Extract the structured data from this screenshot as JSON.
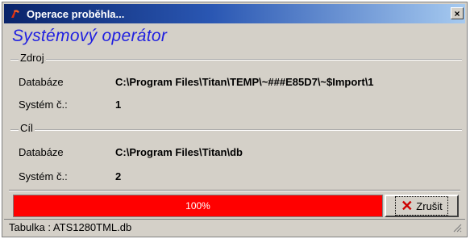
{
  "window": {
    "title": "Operace proběhla...",
    "close_glyph": "×",
    "title_icon": "app-icon"
  },
  "heading": "Systémový operátor",
  "source": {
    "legend": "Zdroj",
    "database_label": "Databáze",
    "database_value": "C:\\Program Files\\Titan\\TEMP\\~###E85D7\\~$Import\\1",
    "system_label": "Systém č.:",
    "system_value": "1"
  },
  "target": {
    "legend": "Cíl",
    "database_label": "Databáze",
    "database_value": "C:\\Program Files\\Titan\\db",
    "system_label": "Systém č.:",
    "system_value": "2"
  },
  "progress": {
    "value_percent": 100,
    "label": "100%",
    "color": "#ff0000"
  },
  "cancel_button": {
    "label": "Zrušit",
    "icon": "x-icon"
  },
  "status": {
    "text": "Tabulka : ATS1280TML.db"
  },
  "colors": {
    "title_start": "#0a246a",
    "title_end": "#a6caf0",
    "heading": "#1f1fe0",
    "face": "#d4d0c8"
  }
}
